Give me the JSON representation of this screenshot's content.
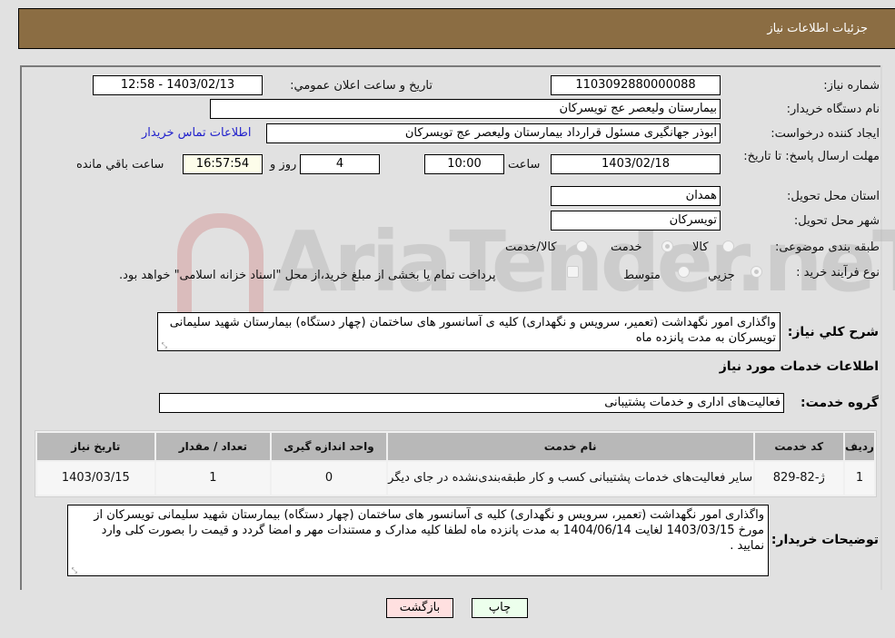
{
  "header": {
    "title": "جزئیات اطلاعات نیاز"
  },
  "fields": {
    "need_number": {
      "label": "شماره نیاز:",
      "value": "1103092880000088"
    },
    "announce_datetime": {
      "label": "تاریخ و ساعت اعلان عمومي:",
      "value": "1403/02/13 - 12:58"
    },
    "buyer_org": {
      "label": "نام دستگاه خریدار:",
      "value": "بیمارستان ولیعصر  عج  تویسرکان"
    },
    "requester": {
      "label": "ایجاد کننده درخواست:",
      "value": "ابوذر جهانگیری مسئول قرارداد بیمارستان ولیعصر  عج  تویسرکان"
    },
    "buyer_contact_link": "اطلاعات تماس خریدار",
    "deadline": {
      "label": "مهلت ارسال پاسخ: تا تاریخ:",
      "date": "1403/02/18",
      "time_label": "ساعت",
      "time": "10:00",
      "days": "4",
      "days_label": "روز و",
      "remaining": "16:57:54",
      "remaining_label": "ساعت باقي مانده"
    },
    "province": {
      "label": "استان محل تحویل:",
      "value": "همدان"
    },
    "city": {
      "label": "شهر محل تحویل:",
      "value": "تویسرکان"
    },
    "category": {
      "label": "طبقه بندی موضوعی:",
      "options": [
        "کالا",
        "خدمت",
        "کالا/خدمت"
      ],
      "selected": "خدمت"
    },
    "purchase_type": {
      "label": "نوع فرآیند خرید :",
      "options": [
        "جزيي",
        "متوسط"
      ],
      "selected": "جزيي",
      "treasury_note": "پرداخت تمام یا بخشی از مبلغ خرید،از محل \"اسناد خزانه اسلامی\" خواهد بود."
    }
  },
  "description": {
    "label": "شرح کلي نیاز:",
    "value": "واگذاری امور نگهداشت (تعمیر، سرویس و نگهداری) کلیه ی آسانسور های ساختمان (چهار دستگاه) بیمارستان شهید سلیمانی تویسرکان به مدت پانزده ماه"
  },
  "services_section": {
    "title": "اطلاعات خدمات مورد نیاز",
    "group_label": "گروه خدمت:",
    "group_value": "فعالیت‌های اداری و خدمات پشتیبانی"
  },
  "table": {
    "headers": [
      "ردیف",
      "کد خدمت",
      "نام خدمت",
      "واحد اندازه گیری",
      "تعداد / مقدار",
      "تاریخ نیاز"
    ],
    "rows": [
      {
        "row": "1",
        "code": "ژ-82-829",
        "name": "سایر فعالیت‌های خدمات پشتیبانی کسب و کار طبقه‌بندی‌نشده در جای دیگر",
        "unit": "0",
        "qty": "1",
        "date": "1403/03/15"
      }
    ]
  },
  "buyer_notes": {
    "label": "توضیحات خریدار:",
    "value": "واگذاری امور نگهداشت (تعمیر، سرویس و نگهداری) کلیه ی آسانسور های ساختمان (چهار دستگاه) بیمارستان شهید سلیمانی تویسرکان از مورخ 1403/03/15 لغایت 1404/06/14 به مدت پانزده ماه لطفا کلیه مدارک و مستندات مهر و امضا گردد و قیمت را بصورت کلی وارد نمایید ."
  },
  "buttons": {
    "print": "چاپ",
    "back": "بازگشت"
  },
  "watermark": {
    "text": "AriaTender.neT"
  }
}
